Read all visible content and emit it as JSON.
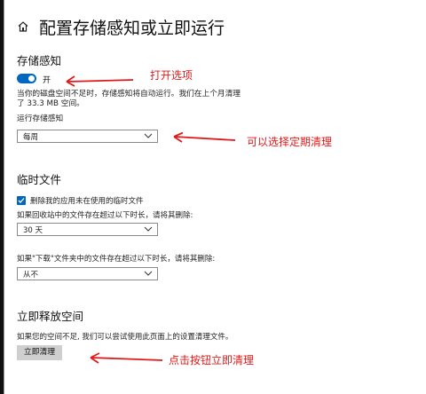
{
  "window": {
    "title": "配置存储感知或立即运行",
    "back_icon": "home-icon"
  },
  "storage_sense": {
    "heading": "存储感知",
    "toggle": {
      "state": "on",
      "label": "开"
    },
    "description_line1": "当你的磁盘空间不足时，存储感知将自动运行。我们在上个月清理",
    "description_line2": "了 33.3 MB 空间。",
    "run_label": "运行存储感知",
    "run_select": {
      "value": "每周"
    }
  },
  "temp_files": {
    "heading": "临时文件",
    "checkbox": {
      "checked": true,
      "label": "删除我的应用未在使用的临时文件"
    },
    "recycle_label": "如果回收站中的文件存在超过以下时长，请将其删除:",
    "recycle_select": {
      "value": "30 天"
    },
    "downloads_label": "如果\"下载\"文件夹中的文件存在超过以下时长，请将其删除:",
    "downloads_select": {
      "value": "从不"
    }
  },
  "free_up": {
    "heading": "立即释放空间",
    "description": "如果您的空间不足, 我们可以尝试使用此页面上的设置清理文件。",
    "button_label": "立即清理"
  },
  "annotations": {
    "open_option": "打开选项",
    "choose_schedule": "可以选择定期清理",
    "click_cleanup": "点击按钮立即清理"
  },
  "colors": {
    "accent": "#0067c0",
    "annotation": "#e01a1a"
  }
}
